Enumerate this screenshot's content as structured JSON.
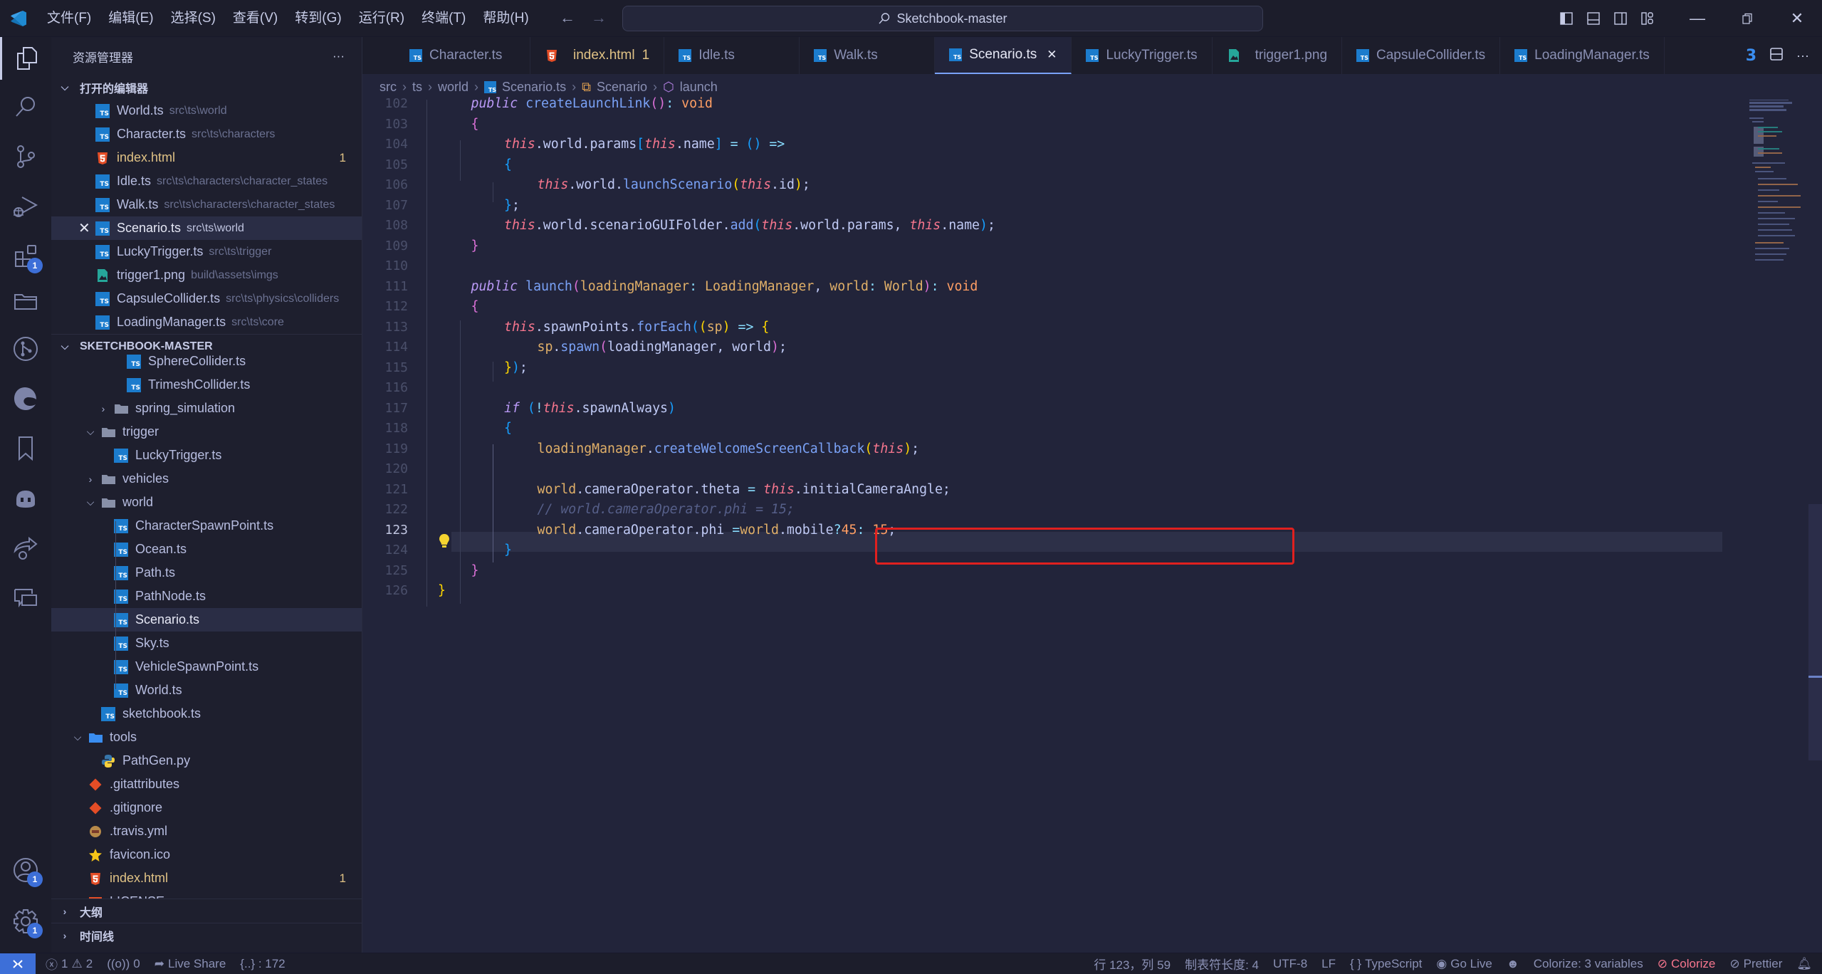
{
  "window": {
    "title": "Sketchbook-master",
    "menu": [
      "文件(F)",
      "编辑(E)",
      "选择(S)",
      "查看(V)",
      "转到(G)",
      "运行(R)",
      "终端(T)",
      "帮助(H)"
    ]
  },
  "activity_bar": {
    "items": [
      {
        "name": "explorer",
        "active": true
      },
      {
        "name": "search"
      },
      {
        "name": "source-control"
      },
      {
        "name": "run-debug"
      },
      {
        "name": "extensions",
        "badge": "1"
      },
      {
        "name": "project-manager"
      },
      {
        "name": "git-graph"
      },
      {
        "name": "edge-devtools"
      },
      {
        "name": "bookmarks"
      },
      {
        "name": "copilot"
      },
      {
        "name": "live-share"
      },
      {
        "name": "remote-explorer"
      }
    ],
    "accounts_badge": "1",
    "settings_badge": "1"
  },
  "sidebar": {
    "title": "资源管理器",
    "more": "···",
    "open_editors": {
      "label": "打开的编辑器",
      "items": [
        {
          "name": "World.ts",
          "desc": "src\\ts\\world",
          "type": "ts"
        },
        {
          "name": "Character.ts",
          "desc": "src\\ts\\characters",
          "type": "ts"
        },
        {
          "name": "index.html",
          "desc": "",
          "type": "html",
          "count": "1"
        },
        {
          "name": "Idle.ts",
          "desc": "src\\ts\\characters\\character_states",
          "type": "ts"
        },
        {
          "name": "Walk.ts",
          "desc": "src\\ts\\characters\\character_states",
          "type": "ts"
        },
        {
          "name": "Scenario.ts",
          "desc": "src\\ts\\world",
          "type": "ts",
          "selected": true
        },
        {
          "name": "LuckyTrigger.ts",
          "desc": "src\\ts\\trigger",
          "type": "ts"
        },
        {
          "name": "trigger1.png",
          "desc": "build\\assets\\imgs",
          "type": "png"
        },
        {
          "name": "CapsuleCollider.ts",
          "desc": "src\\ts\\physics\\colliders",
          "type": "ts"
        },
        {
          "name": "LoadingManager.ts",
          "desc": "src\\ts\\core",
          "type": "ts"
        }
      ]
    },
    "project": {
      "label": "SKETCHBOOK-MASTER",
      "tree": [
        {
          "name": "SphereCollider.ts",
          "type": "ts",
          "depth": 4
        },
        {
          "name": "TrimeshCollider.ts",
          "type": "ts",
          "depth": 4
        },
        {
          "name": "spring_simulation",
          "type": "folder",
          "depth": 3,
          "expanded": false
        },
        {
          "name": "trigger",
          "type": "folder",
          "depth": 2,
          "expanded": true
        },
        {
          "name": "LuckyTrigger.ts",
          "type": "ts",
          "depth": 3
        },
        {
          "name": "vehicles",
          "type": "folder",
          "depth": 2,
          "expanded": false
        },
        {
          "name": "world",
          "type": "folder",
          "depth": 2,
          "expanded": true
        },
        {
          "name": "CharacterSpawnPoint.ts",
          "type": "ts",
          "depth": 3
        },
        {
          "name": "Ocean.ts",
          "type": "ts",
          "depth": 3
        },
        {
          "name": "Path.ts",
          "type": "ts",
          "depth": 3
        },
        {
          "name": "PathNode.ts",
          "type": "ts",
          "depth": 3
        },
        {
          "name": "Scenario.ts",
          "type": "ts",
          "depth": 3,
          "selected": true
        },
        {
          "name": "Sky.ts",
          "type": "ts",
          "depth": 3
        },
        {
          "name": "VehicleSpawnPoint.ts",
          "type": "ts",
          "depth": 3
        },
        {
          "name": "World.ts",
          "type": "ts",
          "depth": 3
        },
        {
          "name": "sketchbook.ts",
          "type": "ts",
          "depth": 2
        },
        {
          "name": "tools",
          "type": "folder-tools",
          "depth": 1,
          "expanded": true
        },
        {
          "name": "PathGen.py",
          "type": "py",
          "depth": 2
        },
        {
          "name": ".gitattributes",
          "type": "git",
          "depth": 1
        },
        {
          "name": ".gitignore",
          "type": "git",
          "depth": 1
        },
        {
          "name": ".travis.yml",
          "type": "travis",
          "depth": 1
        },
        {
          "name": "favicon.ico",
          "type": "star",
          "depth": 1
        },
        {
          "name": "index.html",
          "type": "html",
          "depth": 1,
          "count": "1"
        },
        {
          "name": "LICENSE",
          "type": "license",
          "depth": 1
        }
      ]
    },
    "outline_label": "大纲",
    "timeline_label": "时间线"
  },
  "tabs": [
    {
      "label": "Character.ts",
      "type": "ts"
    },
    {
      "label": "index.html",
      "type": "html",
      "badge": "1"
    },
    {
      "label": "Idle.ts",
      "type": "ts"
    },
    {
      "label": "Walk.ts",
      "type": "ts"
    },
    {
      "label": "Scenario.ts",
      "type": "ts",
      "active": true
    },
    {
      "label": "LuckyTrigger.ts",
      "type": "ts"
    },
    {
      "label": "trigger1.png",
      "type": "png"
    },
    {
      "label": "CapsuleCollider.ts",
      "type": "ts"
    },
    {
      "label": "LoadingManager.ts",
      "type": "ts"
    }
  ],
  "breadcrumb": [
    "src",
    "ts",
    "world",
    "Scenario.ts",
    "Scenario",
    "launch"
  ],
  "editor": {
    "current_line": 123,
    "lines": [
      {
        "n": "102",
        "indent": 1,
        "tokens": [
          [
            "kw-it",
            "public"
          ],
          [
            "",
            ""
          ],
          [
            "fn",
            " createLaunchLink"
          ],
          [
            "p1",
            "()"
          ],
          [
            "op",
            ": "
          ],
          [
            "ty",
            "void"
          ]
        ]
      },
      {
        "n": "103",
        "indent": 1,
        "tokens": [
          [
            "p1",
            "{"
          ]
        ]
      },
      {
        "n": "104",
        "indent": 2,
        "tokens": [
          [
            "this",
            "this"
          ],
          [
            "prop",
            ".world.params"
          ],
          [
            "p2",
            "["
          ],
          [
            "this",
            "this"
          ],
          [
            "prop",
            ".name"
          ],
          [
            "p2",
            "]"
          ],
          [
            "op",
            " = "
          ],
          [
            "p2",
            "()"
          ],
          [
            "op",
            " =>"
          ]
        ]
      },
      {
        "n": "105",
        "indent": 2,
        "tokens": [
          [
            "p2",
            "{"
          ]
        ]
      },
      {
        "n": "106",
        "indent": 3,
        "tokens": [
          [
            "this",
            "this"
          ],
          [
            "prop",
            ".world."
          ],
          [
            "fn",
            "launchScenario"
          ],
          [
            "p3",
            "("
          ],
          [
            "this",
            "this"
          ],
          [
            "prop",
            ".id"
          ],
          [
            "p3",
            ")"
          ],
          [
            "prop",
            ";"
          ]
        ]
      },
      {
        "n": "107",
        "indent": 2,
        "tokens": [
          [
            "p2",
            "}"
          ],
          [
            "prop",
            ";"
          ]
        ]
      },
      {
        "n": "108",
        "indent": 2,
        "tokens": [
          [
            "this",
            "this"
          ],
          [
            "prop",
            ".world.scenarioGUIFolder."
          ],
          [
            "fn",
            "add"
          ],
          [
            "p2",
            "("
          ],
          [
            "this",
            "this"
          ],
          [
            "prop",
            ".world.params, "
          ],
          [
            "this",
            "this"
          ],
          [
            "prop",
            ".name"
          ],
          [
            "p2",
            ")"
          ],
          [
            "prop",
            ";"
          ]
        ]
      },
      {
        "n": "109",
        "indent": 1,
        "tokens": [
          [
            "p1",
            "}"
          ]
        ]
      },
      {
        "n": "110",
        "indent": 0,
        "tokens": []
      },
      {
        "n": "111",
        "indent": 1,
        "tokens": [
          [
            "kw-it",
            "public"
          ],
          [
            "fn",
            " launch"
          ],
          [
            "p1",
            "("
          ],
          [
            "prm",
            "loadingManager"
          ],
          [
            "op",
            ": "
          ],
          [
            "cls",
            "LoadingManager"
          ],
          [
            "prop",
            ", "
          ],
          [
            "prm",
            "world"
          ],
          [
            "op",
            ": "
          ],
          [
            "cls",
            "World"
          ],
          [
            "p1",
            ")"
          ],
          [
            "op",
            ": "
          ],
          [
            "ty",
            "void"
          ]
        ]
      },
      {
        "n": "112",
        "indent": 1,
        "tokens": [
          [
            "p1",
            "{"
          ]
        ]
      },
      {
        "n": "113",
        "indent": 2,
        "tokens": [
          [
            "this",
            "this"
          ],
          [
            "prop",
            ".spawnPoints."
          ],
          [
            "fn",
            "forEach"
          ],
          [
            "p2",
            "("
          ],
          [
            "p3",
            "("
          ],
          [
            "prm",
            "sp"
          ],
          [
            "p3",
            ")"
          ],
          [
            "op",
            " => "
          ],
          [
            "p3",
            "{"
          ]
        ]
      },
      {
        "n": "114",
        "indent": 3,
        "tokens": [
          [
            "prm",
            "sp"
          ],
          [
            "prop",
            "."
          ],
          [
            "fn",
            "spawn"
          ],
          [
            "p1",
            "("
          ],
          [
            "prop",
            "loadingManager, world"
          ],
          [
            "p1",
            ")"
          ],
          [
            "prop",
            ";"
          ]
        ]
      },
      {
        "n": "115",
        "indent": 2,
        "tokens": [
          [
            "p3",
            "}"
          ],
          [
            "p2",
            ")"
          ],
          [
            "prop",
            ";"
          ]
        ]
      },
      {
        "n": "116",
        "indent": 0,
        "tokens": []
      },
      {
        "n": "117",
        "indent": 2,
        "tokens": [
          [
            "kw-it",
            "if"
          ],
          [
            "prop",
            " "
          ],
          [
            "p2",
            "("
          ],
          [
            "op",
            "!"
          ],
          [
            "this",
            "this"
          ],
          [
            "prop",
            ".spawnAlways"
          ],
          [
            "p2",
            ")"
          ]
        ]
      },
      {
        "n": "118",
        "indent": 2,
        "tokens": [
          [
            "p2",
            "{"
          ]
        ]
      },
      {
        "n": "119",
        "indent": 3,
        "tokens": [
          [
            "prm",
            "loadingManager"
          ],
          [
            "prop",
            "."
          ],
          [
            "fn",
            "createWelcomeScreenCallback"
          ],
          [
            "p3",
            "("
          ],
          [
            "this",
            "this"
          ],
          [
            "p3",
            ")"
          ],
          [
            "prop",
            ";"
          ]
        ]
      },
      {
        "n": "120",
        "indent": 0,
        "tokens": []
      },
      {
        "n": "121",
        "indent": 3,
        "tokens": [
          [
            "prm",
            "world"
          ],
          [
            "prop",
            ".cameraOperator.theta "
          ],
          [
            "op",
            "="
          ],
          [
            "prop",
            " "
          ],
          [
            "this",
            "this"
          ],
          [
            "prop",
            ".initialCameraAngle;"
          ]
        ]
      },
      {
        "n": "122",
        "indent": 3,
        "tokens": [
          [
            "cmt",
            "// world.cameraOperator.phi = 15;"
          ]
        ]
      },
      {
        "n": "123",
        "indent": 3,
        "tokens": [
          [
            "prm",
            "world"
          ],
          [
            "prop",
            ".cameraOperator.phi "
          ],
          [
            "op",
            "="
          ],
          [
            "prm",
            "world"
          ],
          [
            "prop",
            ".mobile"
          ],
          [
            "op",
            "?"
          ],
          [
            "num",
            "45"
          ],
          [
            "op",
            ": "
          ],
          [
            "num",
            "15"
          ],
          [
            "prop",
            ";"
          ]
        ]
      },
      {
        "n": "124",
        "indent": 2,
        "tokens": [
          [
            "p2",
            "}"
          ]
        ]
      },
      {
        "n": "125",
        "indent": 1,
        "tokens": [
          [
            "p1",
            "}"
          ]
        ]
      },
      {
        "n": "126",
        "indent": 0,
        "tokens": [
          [
            "p3",
            "}"
          ]
        ]
      }
    ]
  },
  "statusbar": {
    "errors": "1",
    "warnings": "2",
    "ports": "0",
    "live_share": "Live Share",
    "symbols": "{..} : 172",
    "position": "行 123，列 59",
    "tab_size": "制表符长度: 4",
    "encoding": "UTF-8",
    "eol": "LF",
    "language": "TypeScript",
    "go_live": "Go Live",
    "colorize_vars": "Colorize: 3 variables",
    "colorize": "Colorize",
    "prettier": "Prettier"
  },
  "colors": {
    "accent": "#3d6fd8",
    "highlight_box": "#e0201f",
    "modified": "#e0c285"
  }
}
